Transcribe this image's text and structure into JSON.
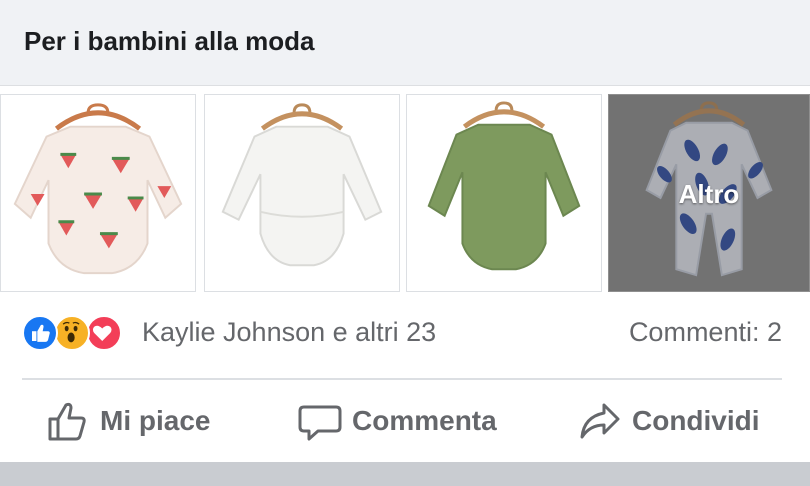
{
  "header": {
    "title": "Per i bambini alla moda"
  },
  "photos": [
    {
      "name": "photo-watermelon-onesie",
      "icon": "watermelon-onesie"
    },
    {
      "name": "photo-white-onesie",
      "icon": "white-onesie"
    },
    {
      "name": "photo-green-onesie",
      "icon": "green-onesie"
    },
    {
      "name": "photo-blue-leaf-sleeper",
      "icon": "blue-leaf-sleeper",
      "overlay_label": "Altro"
    }
  ],
  "reactions": {
    "icons": [
      "like-icon",
      "wow-icon",
      "love-icon"
    ],
    "text": "Kaylie Johnson e altri 23",
    "comments": "Commenti: 2"
  },
  "actions": {
    "like": "Mi piace",
    "comment": "Commenta",
    "share": "Condividi"
  },
  "colors": {
    "like_blue": "#1877f2",
    "love_red": "#f33e58",
    "wow_yellow": "#f7b125",
    "muted_text": "#65676b",
    "header_bg": "#f0f2f5"
  }
}
